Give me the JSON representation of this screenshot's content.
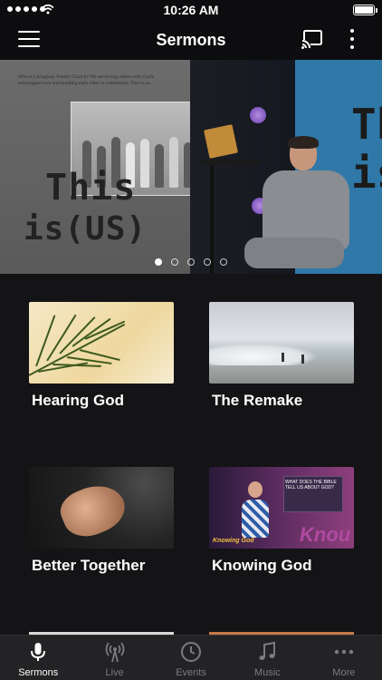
{
  "status_bar": {
    "time": "10:26 AM",
    "battery_level": 1.0,
    "signal_bars": 5
  },
  "nav_bar": {
    "title": "Sermons",
    "menu_icon": "hamburger-icon",
    "cast_icon": "cast-icon",
    "more_icon": "vertical-ellipsis-icon"
  },
  "hero": {
    "quote": "Who is Livingway Family Church? We are loving others with God's extravagant love and building each other in community. This is us...",
    "word_this": "This",
    "word_is_us": "is(US)",
    "screen_text_1": "Th",
    "screen_text_2": "is",
    "slide_count": 5,
    "active_slide": 1
  },
  "sermons": [
    {
      "title": "Hearing God"
    },
    {
      "title": "The Remake"
    },
    {
      "title": "Better Together"
    },
    {
      "title": "Knowing God",
      "thumb_text": "Knowing God",
      "stage_text": "WHAT DOES THE BIBLE TELL US ABOUT GOD?",
      "stage_big": "Knou"
    }
  ],
  "tab_bar": {
    "items": [
      {
        "label": "Sermons",
        "icon": "microphone-icon",
        "active": true
      },
      {
        "label": "Live",
        "icon": "broadcast-icon",
        "active": false
      },
      {
        "label": "Events",
        "icon": "clock-icon",
        "active": false
      },
      {
        "label": "Music",
        "icon": "music-note-icon",
        "active": false
      },
      {
        "label": "More",
        "icon": "more-dots-icon",
        "active": false
      }
    ]
  },
  "colors": {
    "background": "#141416",
    "tab_active": "#ffffff",
    "tab_inactive": "#7b7b80"
  }
}
